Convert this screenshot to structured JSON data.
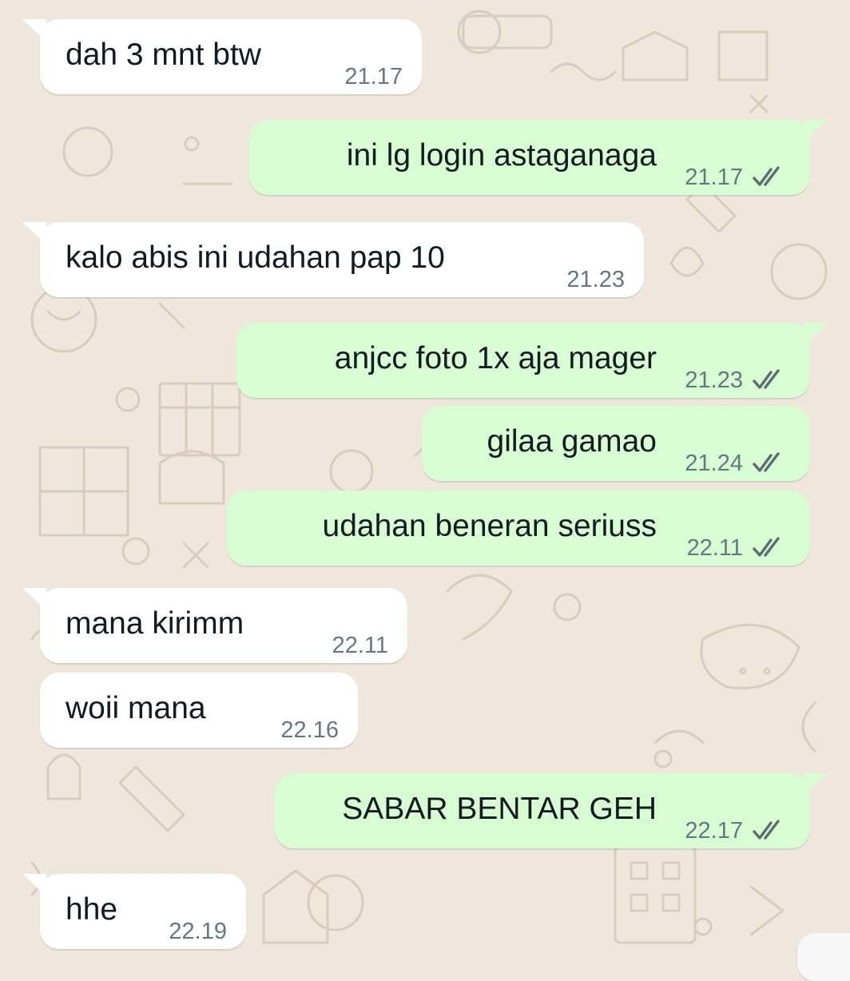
{
  "colors": {
    "wallpaper": "#efe7dc",
    "incoming_bubble": "#ffffff",
    "outgoing_bubble": "#d9fdd3",
    "text": "#111b21",
    "timestamp": "#667781",
    "read_receipt": "#5f6b72"
  },
  "icons": {
    "read_receipt": "double-check-icon"
  },
  "messages": [
    {
      "direction": "in",
      "text": "dah 3 mnt btw",
      "time": "21.17"
    },
    {
      "direction": "out",
      "text": "ini lg login astaganaga",
      "time": "21.17",
      "status": "read"
    },
    {
      "direction": "in",
      "text": "kalo abis ini udahan pap 10",
      "time": "21.23"
    },
    {
      "direction": "out",
      "text": "anjcc foto 1x aja mager",
      "time": "21.23",
      "status": "read"
    },
    {
      "direction": "out",
      "text": "gilaa gamao",
      "time": "21.24",
      "status": "read"
    },
    {
      "direction": "out",
      "text": "udahan beneran seriuss",
      "time": "22.11",
      "status": "read"
    },
    {
      "direction": "in",
      "text": "mana kirimm",
      "time": "22.11"
    },
    {
      "direction": "in",
      "text": "woii mana",
      "time": "22.16"
    },
    {
      "direction": "out",
      "text": "SABAR BENTAR GEH",
      "time": "22.17",
      "status": "read"
    },
    {
      "direction": "in",
      "text": "hhe",
      "time": "22.19"
    }
  ]
}
